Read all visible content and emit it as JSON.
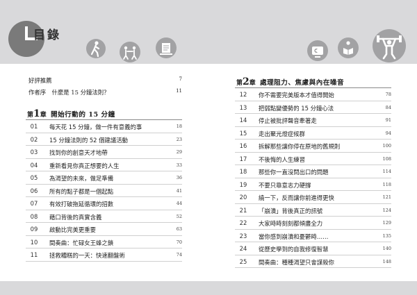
{
  "header": {
    "title": "目錄"
  },
  "header_icons": [
    "walking-person-icon",
    "tennis-players-icon",
    "writing-desk-icon",
    "pacman-tv-icon",
    "reading-book-icon",
    "weightlifter-icon"
  ],
  "preface": [
    {
      "title": "好評推薦",
      "page": "7"
    },
    {
      "title": "作者序　什麼是 15 分鐘法則？",
      "page": "11"
    }
  ],
  "chapter1": {
    "label": "第",
    "number": "1",
    "suffix": "章",
    "title": "開始行動的 15 分鐘",
    "items": [
      {
        "num": "01",
        "title": "每天花 15 分鐘，做一件有意義的事",
        "page": "18"
      },
      {
        "num": "02",
        "title": "15 分鐘法則的 52 個建議活動",
        "page": "23"
      },
      {
        "num": "03",
        "title": "找到你的創意天才地帶",
        "page": "29"
      },
      {
        "num": "04",
        "title": "重新看見你真正想要的人生",
        "page": "33"
      },
      {
        "num": "05",
        "title": "為渴望的未來，做足準備",
        "page": "36"
      },
      {
        "num": "06",
        "title": "所有的點子都是一個起點",
        "page": "41"
      },
      {
        "num": "07",
        "title": "有效打破拖延循環的招數",
        "page": "44"
      },
      {
        "num": "08",
        "title": "藉口背後的真實含義",
        "page": "52"
      },
      {
        "num": "09",
        "title": "啟動比完美更重要",
        "page": "63"
      },
      {
        "num": "10",
        "title": "間奏曲：忙碌女王蜂之鎖",
        "page": "70"
      },
      {
        "num": "11",
        "title": "拯救糟糕的一天：快速翻盤術",
        "page": "74"
      }
    ]
  },
  "chapter2": {
    "label": "第",
    "number": "2",
    "suffix": "章",
    "title": "處理阻力、焦慮與內在噪音",
    "items": [
      {
        "num": "12",
        "title": "你不需要完美版本才值得開始",
        "page": "78"
      },
      {
        "num": "13",
        "title": "把弱點變優勢的 15 分鐘心法",
        "page": "84"
      },
      {
        "num": "14",
        "title": "停止被批評聲音牽著走",
        "page": "91"
      },
      {
        "num": "15",
        "title": "走出聚光燈症候群",
        "page": "94"
      },
      {
        "num": "16",
        "title": "拆解那些讓你停在原地的舊規則",
        "page": "100"
      },
      {
        "num": "17",
        "title": "不後悔的人生練習",
        "page": "108"
      },
      {
        "num": "18",
        "title": "那些你一直沒問出口的問題",
        "page": "114"
      },
      {
        "num": "19",
        "title": "不要只靠意志力硬撐",
        "page": "118"
      },
      {
        "num": "20",
        "title": "繞一下，反而讓你前進得更快",
        "page": "121"
      },
      {
        "num": "21",
        "title": "「崩潰」背後真正的訊號",
        "page": "124"
      },
      {
        "num": "22",
        "title": "大家時時刻刻都傾盡全力",
        "page": "129"
      },
      {
        "num": "23",
        "title": "當你感到崩潰和憂鬱時……",
        "page": "135"
      },
      {
        "num": "24",
        "title": "從歷史學到的自我修復智慧",
        "page": "140"
      },
      {
        "num": "25",
        "title": "間奏曲：種種渴望只會謀殺你",
        "page": "148"
      }
    ]
  }
}
